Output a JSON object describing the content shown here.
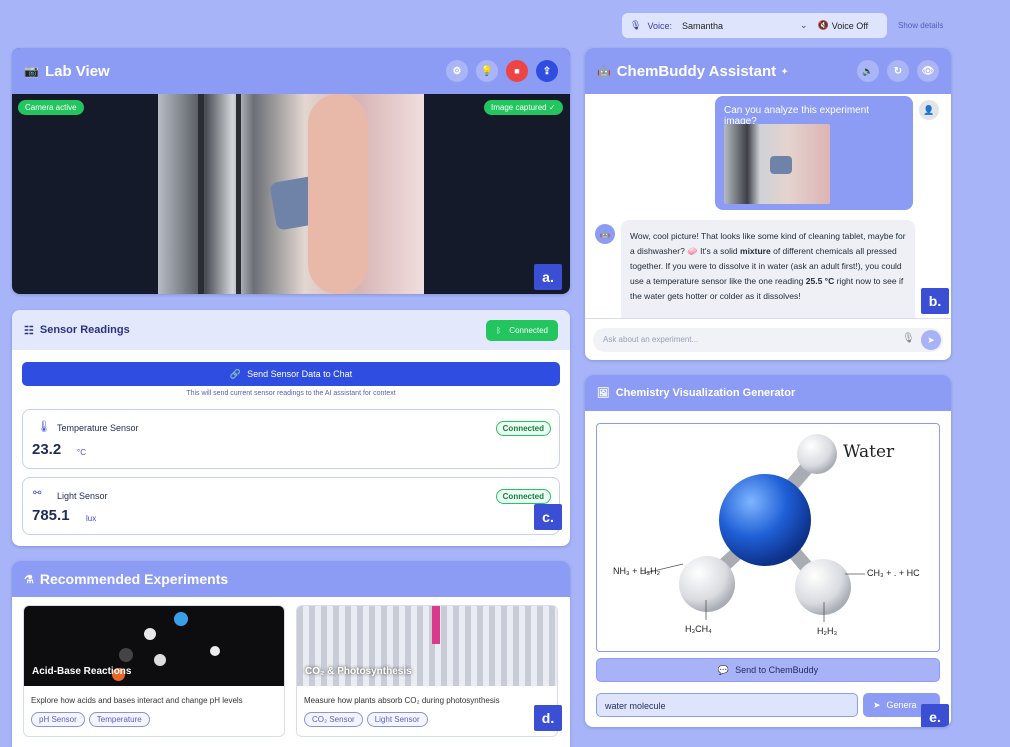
{
  "voice_bar": {
    "label": "Voice:",
    "voice": "Samantha",
    "voice_off": "Voice Off",
    "show_details": "Show details"
  },
  "lab_view": {
    "title": "Lab View",
    "camera_status": "Camera active",
    "capture_status": "Image captured ✓",
    "marker": "a."
  },
  "sensor_readings": {
    "title": "Sensor Readings",
    "status": "Connected",
    "send_button": "Send Sensor Data to Chat",
    "hint": "This will send current sensor readings to the AI assistant for context",
    "sensors": [
      {
        "name": "Temperature Sensor",
        "status": "Connected",
        "value": "23.2",
        "unit": "°C"
      },
      {
        "name": "Light Sensor",
        "status": "Connected",
        "value": "785.1",
        "unit": "lux"
      }
    ],
    "marker": "c."
  },
  "experiments": {
    "title": "Recommended Experiments",
    "items": [
      {
        "title": "Acid-Base Reactions",
        "desc": "Explore how acids and bases interact and change pH levels",
        "tags": [
          "pH Sensor",
          "Temperature"
        ]
      },
      {
        "title": "CO₂ & Photosynthesis",
        "desc": "Measure how plants absorb CO₂ during photosynthesis",
        "tags": [
          "CO₂ Sensor",
          "Light Sensor"
        ]
      }
    ],
    "marker": "d."
  },
  "assistant": {
    "title": "ChemBuddy Assistant",
    "user_message": "Can you analyze this experiment image?",
    "bot_message": {
      "p1": "Wow, cool picture! That looks like some kind of cleaning tablet, maybe for a dishwasher? 🧼 It's a solid ",
      "bold1": "mixture",
      "p2": " of different chemicals all pressed together. If you were to dissolve it in water (ask an adult first!), you could use a temperature sensor like the one reading ",
      "bold2": "25.5 °C",
      "p3": " right now to see if the water gets hotter or colder as it dissolves!"
    },
    "input_placeholder": "Ask about an experiment...",
    "marker": "b."
  },
  "viz": {
    "title": "Chemistry Visualization Generator",
    "image_labels": {
      "title": "Water",
      "left": "NH₃ + H₃H₂",
      "bottom_left": "H₃CH₄",
      "bottom_right": "H₂H₃",
      "right": "CH₃ + . + HC"
    },
    "send_button": "Send to ChemBuddy",
    "input_value": "water molecule",
    "generate_button": "Genera",
    "marker": "e."
  },
  "colors": {
    "accent": "#8c9cf5",
    "primary": "#2f4de0",
    "success": "#22c55e",
    "danger": "#ef4444",
    "page_bg": "#a7b4f8"
  }
}
